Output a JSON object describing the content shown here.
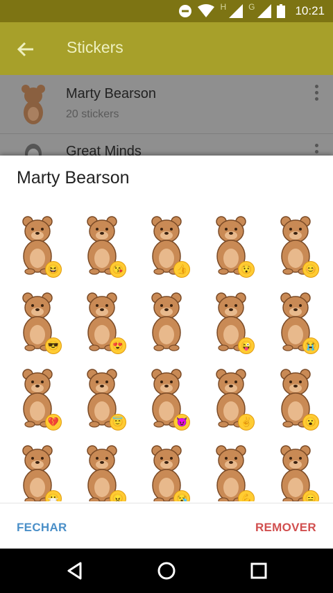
{
  "status_bar": {
    "time": "10:21",
    "net_1": "H",
    "net_2": "G"
  },
  "app_bar": {
    "title": "Stickers"
  },
  "sticker_sets": [
    {
      "name": "Marty Bearson",
      "count": "20 stickers"
    },
    {
      "name": "Great Minds",
      "count": ""
    }
  ],
  "sheet": {
    "title": "Marty Bearson",
    "close_label": "FECHAR",
    "remove_label": "REMOVER"
  },
  "stickers": [
    "laughing",
    "kissing",
    "thumbs-up",
    "surprised",
    "smiling",
    "sunglasses",
    "heart-eyes",
    "",
    "winking",
    "crying",
    "broken-heart",
    "halo",
    "smiling-devil",
    "victory",
    "astonished",
    "mask",
    "angry",
    "sleeping",
    "flexed-biceps",
    "neutral"
  ],
  "colors": {
    "status_bar": "#7d7413",
    "app_bar": "#a7a02a",
    "bear": "#c98a55",
    "close_button": "#4a8fc8",
    "remove_button": "#d14f4f"
  }
}
